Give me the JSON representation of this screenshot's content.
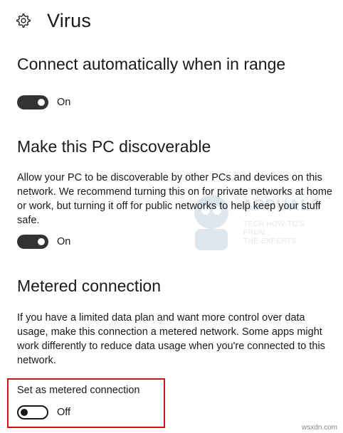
{
  "header": {
    "title": "Virus",
    "icon": "gear-icon"
  },
  "connect_auto": {
    "heading": "Connect automatically when in range",
    "toggle_state": "On"
  },
  "discoverable": {
    "heading": "Make this PC discoverable",
    "description": "Allow your PC to be discoverable by other PCs and devices on this network. We recommend turning this on for private networks at home or work, but turning it off for public networks to help keep your stuff safe.",
    "toggle_state": "On"
  },
  "metered": {
    "heading": "Metered connection",
    "description": "If you have a limited data plan and want more control over data usage, make this connection a metered network. Some apps might work differently to reduce data usage when you're connected to this network.",
    "setting_label": "Set as metered connection",
    "toggle_state": "Off",
    "highlight_color": "#d01414"
  },
  "watermark": {
    "brand": "APPUALS",
    "tagline_1": "TECH HOW-TO'S FROM",
    "tagline_2": "THE EXPERTS"
  },
  "site_mark": "wsxdn.com"
}
